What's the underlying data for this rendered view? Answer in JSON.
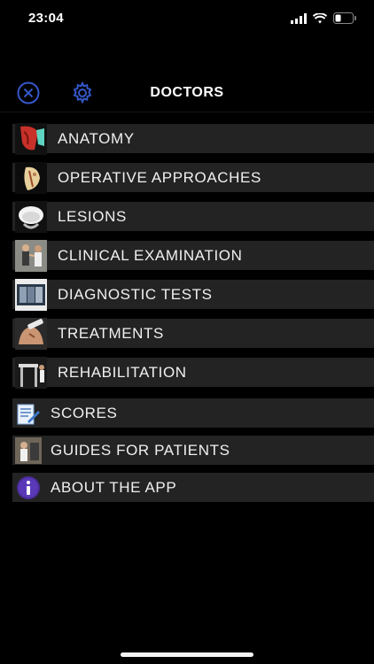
{
  "status_bar": {
    "time": "23:04"
  },
  "header": {
    "title": "DOCTORS"
  },
  "menu": {
    "items": [
      {
        "label": "ANATOMY",
        "icon": "shoulder-anatomy-icon"
      },
      {
        "label": "OPERATIVE APPROACHES",
        "icon": "operative-approach-icon"
      },
      {
        "label": "LESIONS",
        "icon": "lesion-icon"
      },
      {
        "label": "CLINICAL EXAMINATION",
        "icon": "clinical-exam-icon"
      },
      {
        "label": "DIAGNOSTIC TESTS",
        "icon": "xray-icon"
      },
      {
        "label": "TREATMENTS",
        "icon": "treatment-icon"
      },
      {
        "label": "REHABILITATION",
        "icon": "rehabilitation-icon"
      },
      {
        "label": "SCORES",
        "icon": "document-edit-icon"
      },
      {
        "label": "GUIDES FOR PATIENTS",
        "icon": "patient-guide-icon"
      },
      {
        "label": "ABOUT THE APP",
        "icon": "info-icon"
      }
    ]
  },
  "colors": {
    "accent": "#3557c8",
    "row_bg": "#232323",
    "background": "#000000"
  }
}
